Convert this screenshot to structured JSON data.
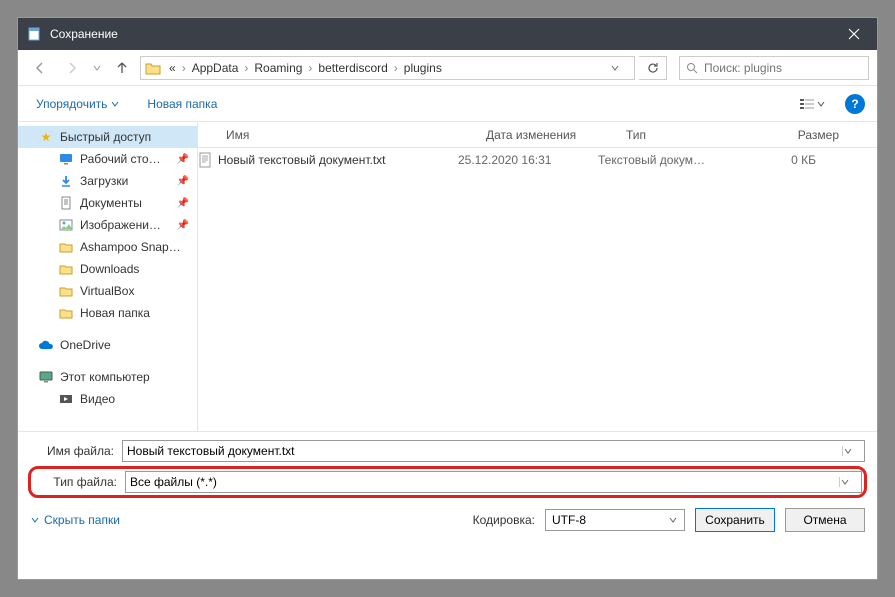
{
  "window": {
    "title": "Сохранение"
  },
  "breadcrumbs": {
    "prefix": "«",
    "items": [
      "AppData",
      "Roaming",
      "betterdiscord",
      "plugins"
    ]
  },
  "search": {
    "placeholder": "Поиск: plugins"
  },
  "toolbar": {
    "organize": "Упорядочить",
    "new_folder": "Новая папка"
  },
  "sidebar": {
    "quick_access": "Быстрый доступ",
    "desktop": "Рабочий сто…",
    "downloads": "Загрузки",
    "documents": "Документы",
    "pictures": "Изображени…",
    "ashampoo": "Ashampoo Snap…",
    "downloads_en": "Downloads",
    "virtualbox": "VirtualBox",
    "new_folder": "Новая папка",
    "onedrive": "OneDrive",
    "this_pc": "Этот компьютер",
    "video": "Видео"
  },
  "columns": {
    "name": "Имя",
    "date": "Дата изменения",
    "type": "Тип",
    "size": "Размер"
  },
  "files": [
    {
      "name": "Новый текстовый документ.txt",
      "date": "25.12.2020 16:31",
      "type": "Текстовый докум…",
      "size": "0 КБ"
    }
  ],
  "fields": {
    "filename_label": "Имя файла:",
    "filename_value": "Новый текстовый документ.txt",
    "filetype_label": "Тип файла:",
    "filetype_value": "Все файлы  (*.*)"
  },
  "footer": {
    "hide_folders": "Скрыть папки",
    "encoding_label": "Кодировка:",
    "encoding_value": "UTF-8",
    "save": "Сохранить",
    "cancel": "Отмена"
  }
}
